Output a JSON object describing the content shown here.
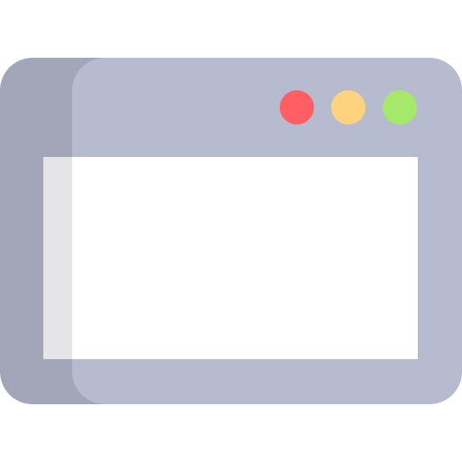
{
  "icon": {
    "name": "browser-window-icon",
    "colors": {
      "frame": "#b6bbcf",
      "frame_shadow": "#a2a6b8",
      "content": "#ffffff",
      "content_strip": "#e5e5e7"
    }
  },
  "window_controls": [
    {
      "name": "close-dot",
      "color": "#ff5f63"
    },
    {
      "name": "minimize-dot",
      "color": "#ffd37e"
    },
    {
      "name": "maximize-dot",
      "color": "#a6e86a"
    }
  ]
}
